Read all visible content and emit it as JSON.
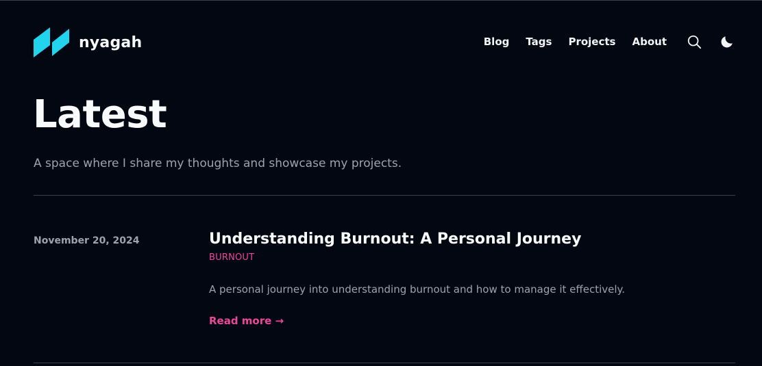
{
  "site": {
    "name": "nyagah",
    "logo_icon": "slashes-logo-icon",
    "accent_color": "#ec4899",
    "logo_color": "#22d3ee"
  },
  "nav": {
    "items": [
      {
        "label": "Blog"
      },
      {
        "label": "Tags"
      },
      {
        "label": "Projects"
      },
      {
        "label": "About"
      }
    ],
    "search_icon": "search-icon",
    "theme_icon": "moon-icon"
  },
  "hero": {
    "title": "Latest",
    "subtitle": "A space where I share my thoughts and showcase my projects."
  },
  "posts": [
    {
      "date": "November 20, 2024",
      "title": "Understanding Burnout: A Personal Journey",
      "tag": "BURNOUT",
      "summary": "A personal journey into understanding burnout and how to manage it effectively.",
      "read_more": "Read more →"
    }
  ]
}
